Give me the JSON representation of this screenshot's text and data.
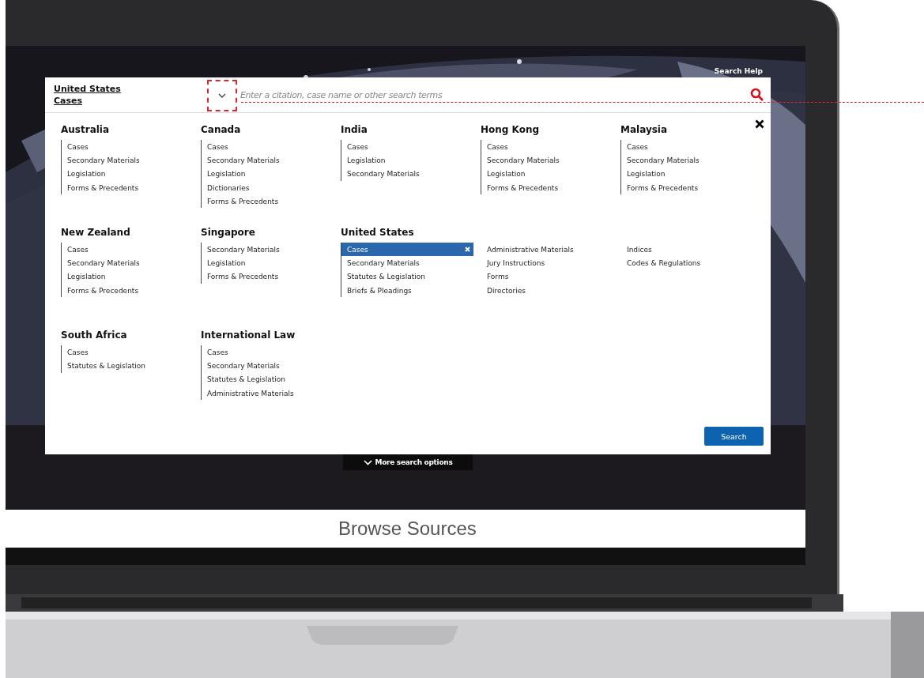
{
  "header_link": "Search Help",
  "scope_lines": [
    "United States",
    "Cases"
  ],
  "search": {
    "placeholder": "Enter a citation, case name or other search terms"
  },
  "jurisdictions": [
    {
      "name": "Australia",
      "columns": [
        [
          {
            "label": "Cases",
            "selected": false
          },
          {
            "label": "Secondary Materials",
            "selected": false
          },
          {
            "label": "Legislation",
            "selected": false
          },
          {
            "label": "Forms & Precedents",
            "selected": false
          }
        ]
      ]
    },
    {
      "name": "Canada",
      "columns": [
        [
          {
            "label": "Cases",
            "selected": false
          },
          {
            "label": "Secondary Materials",
            "selected": false
          },
          {
            "label": "Legislation",
            "selected": false
          },
          {
            "label": "Dictionaries",
            "selected": false
          },
          {
            "label": "Forms & Precedents",
            "selected": false
          }
        ]
      ]
    },
    {
      "name": "India",
      "columns": [
        [
          {
            "label": "Cases",
            "selected": false
          },
          {
            "label": "Legislation",
            "selected": false
          },
          {
            "label": "Secondary Materials",
            "selected": false
          }
        ]
      ]
    },
    {
      "name": "Hong Kong",
      "columns": [
        [
          {
            "label": "Cases",
            "selected": false
          },
          {
            "label": "Secondary Materials",
            "selected": false
          },
          {
            "label": "Legislation",
            "selected": false
          },
          {
            "label": "Forms & Precedents",
            "selected": false
          }
        ]
      ]
    },
    {
      "name": "Malaysia",
      "columns": [
        [
          {
            "label": "Cases",
            "selected": false
          },
          {
            "label": "Secondary Materials",
            "selected": false
          },
          {
            "label": "Legislation",
            "selected": false
          },
          {
            "label": "Forms & Precedents",
            "selected": false
          }
        ]
      ]
    },
    {
      "name": "New Zealand",
      "columns": [
        [
          {
            "label": "Cases",
            "selected": false
          },
          {
            "label": "Secondary Materials",
            "selected": false
          },
          {
            "label": "Legislation",
            "selected": false
          },
          {
            "label": "Forms & Precedents",
            "selected": false
          }
        ]
      ]
    },
    {
      "name": "Singapore",
      "columns": [
        [
          {
            "label": "Secondary Materials",
            "selected": false
          },
          {
            "label": "Legislation",
            "selected": false
          },
          {
            "label": "Forms & Precedents",
            "selected": false
          }
        ]
      ]
    },
    {
      "name": "United States",
      "columns": [
        [
          {
            "label": "Cases",
            "selected": true
          },
          {
            "label": "Secondary Materials",
            "selected": false
          },
          {
            "label": "Statutes & Legislation",
            "selected": false
          },
          {
            "label": "Briefs & Pleadings",
            "selected": false
          }
        ],
        [
          {
            "label": "Administrative Materials",
            "selected": false
          },
          {
            "label": "Jury Instructions",
            "selected": false
          },
          {
            "label": "Forms",
            "selected": false
          },
          {
            "label": "Directories",
            "selected": false
          }
        ],
        [
          {
            "label": "Indices",
            "selected": false
          },
          {
            "label": "Codes & Regulations",
            "selected": false
          }
        ]
      ]
    },
    {
      "name": "South Africa",
      "columns": [
        [
          {
            "label": "Cases",
            "selected": false
          },
          {
            "label": "Statutes & Legislation",
            "selected": false
          }
        ]
      ]
    },
    {
      "name": "International Law",
      "columns": [
        [
          {
            "label": "Cases",
            "selected": false
          },
          {
            "label": "Secondary Materials",
            "selected": false
          },
          {
            "label": "Statutes & Legislation",
            "selected": false
          },
          {
            "label": "Administrative Materials",
            "selected": false
          }
        ]
      ]
    }
  ],
  "search_button": "Search",
  "more_options": "More search options",
  "section_title": "Browse Sources"
}
